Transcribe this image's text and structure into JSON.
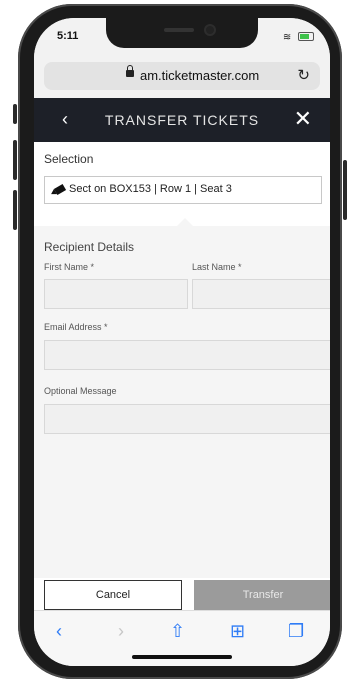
{
  "status": {
    "time": "5:11",
    "icons": "wifi-icon battery-icon"
  },
  "browser": {
    "url": "am.ticketmaster.com"
  },
  "header": {
    "title": "TRANSFER TICKETS"
  },
  "selection": {
    "label": "Selection",
    "value": "Sect on BOX153 | Row 1 | Seat 3"
  },
  "recipient": {
    "label": "Recipient Details",
    "first_name_label": "First Name *",
    "last_name_label": "Last Name *",
    "email_label": "Email Address *",
    "message_label": "Optional Message",
    "first_name_value": "",
    "last_name_value": "",
    "email_value": "",
    "message_value": ""
  },
  "actions": {
    "cancel": "Cancel",
    "transfer": "Transfer"
  },
  "colors": {
    "header_bg": "#1d2028",
    "transfer_bg": "#9b9b9b",
    "toolbar_accent": "#2f7cf6"
  }
}
